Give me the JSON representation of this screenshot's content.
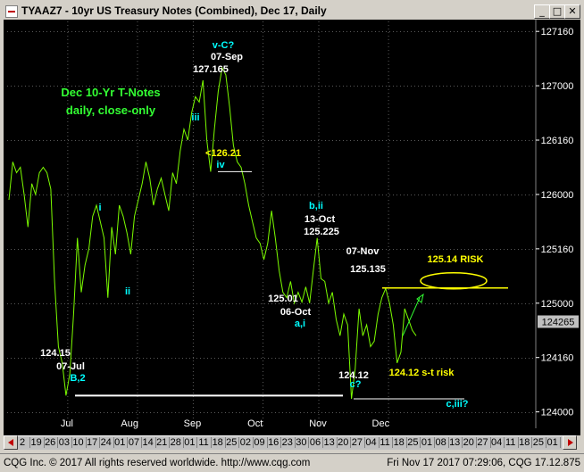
{
  "window": {
    "title": "TYAAZ7 - 10yr US Treasury Notes (Combined), Dec 17, Daily",
    "minimize_glyph": "_",
    "maximize_glyph": "□",
    "close_glyph": "✕",
    "icons": [
      "app-icon",
      "minimize-icon",
      "maximize-icon",
      "close-icon",
      "scroll-left-icon",
      "scroll-right-icon"
    ]
  },
  "status": {
    "left": "CQG Inc. © 2017 All rights reserved worldwide. http://www.cqg.com",
    "right": "Fri Nov 17 2017 07:29:06, CQG 17.12.875"
  },
  "colors": {
    "background": "#000000",
    "price_line": "#7cfc00",
    "label_white": "#ffffff",
    "label_cyan": "#00ffff",
    "label_yellow": "#ffff00",
    "annotation_green": "#33ff33",
    "grid": "#5a5a5a",
    "axis_text": "#ffffff",
    "time_axis_bg": "#c0c0c0",
    "price_box_bg": "#c0c0c0"
  },
  "chart_data": {
    "type": "line",
    "symbol": "TYAAZ7",
    "price_axis": {
      "min": 123.85,
      "max": 127.4,
      "tick_values": [
        127.5,
        127.0,
        126.5,
        126.0,
        125.5,
        125.0,
        124.5,
        124.0
      ],
      "tick_labels": [
        "127160",
        "127000",
        "126160",
        "126000",
        "125160",
        "125000",
        "124160",
        "124000"
      ],
      "last_price_label": "124265",
      "last_price_value": 124.83
    },
    "time_axis": {
      "day_labels": [
        "2",
        "19",
        "26",
        "03",
        "10",
        "17",
        "24",
        "01",
        "07",
        "14",
        "21",
        "28",
        "01",
        "11",
        "18",
        "25",
        "02",
        "09",
        "16",
        "23",
        "30",
        "06",
        "13",
        "20",
        "27",
        "04",
        "11",
        "18",
        "25",
        "01",
        "08",
        "13",
        "20",
        "27",
        "04",
        "11",
        "18",
        "25",
        "01"
      ],
      "month_labels": [
        {
          "text": "Jul",
          "index": 4.5
        },
        {
          "text": "Aug",
          "index": 9
        },
        {
          "text": "Sep",
          "index": 13.5
        },
        {
          "text": "Oct",
          "index": 18
        },
        {
          "text": "Nov",
          "index": 22.5
        },
        {
          "text": "Dec",
          "index": 27
        }
      ],
      "highlighted_labels": [
        "01",
        "Dec",
        "17"
      ]
    },
    "series": [
      {
        "values": [
          125.95,
          126.3,
          126.2,
          126.25,
          126.0,
          125.7,
          126.1,
          126.0,
          126.2,
          126.25,
          126.2,
          126.05,
          125.2,
          124.6,
          124.45,
          124.15,
          124.35,
          124.9,
          125.6,
          125.1,
          125.35,
          125.5,
          125.8,
          125.9,
          125.75,
          125.6,
          125.05,
          125.7,
          125.45,
          125.9,
          125.8,
          125.65,
          125.45,
          125.8,
          125.95,
          126.1,
          126.3,
          126.15,
          125.9,
          126.05,
          126.15,
          126.0,
          125.85,
          126.2,
          126.1,
          126.4,
          126.6,
          126.5,
          126.75,
          126.9,
          126.85,
          127.05,
          126.5,
          126.21,
          126.6,
          126.95,
          127.165,
          127.1,
          126.8,
          126.45,
          126.3,
          126.25,
          126.1,
          125.9,
          125.75,
          125.6,
          125.55,
          125.4,
          125.55,
          125.85,
          125.6,
          125.3,
          125.1,
          125.05,
          125.2,
          125.0,
          125.1,
          125.01,
          125.15,
          125.0,
          125.3,
          125.6,
          125.225,
          125.2,
          125.0,
          125.1,
          124.85,
          124.7,
          124.9,
          124.8,
          124.12,
          124.4,
          124.95,
          124.7,
          124.8,
          124.6,
          124.65,
          124.9,
          125.05,
          125.135,
          125.0,
          124.8,
          124.45,
          124.55,
          124.95,
          124.85,
          124.75,
          124.7
        ]
      }
    ],
    "annotations": [
      {
        "text": "Dec 10-Yr T-Notes",
        "color": "green"
      },
      {
        "text": "daily, close-only",
        "color": "green"
      },
      {
        "text": "v-C?",
        "color": "cyan"
      },
      {
        "text": "07-Sep",
        "color": "white"
      },
      {
        "text": "127.165",
        "color": "white"
      },
      {
        "text": "iii",
        "color": "cyan"
      },
      {
        "text": "<126.21",
        "color": "yellow"
      },
      {
        "text": "iv",
        "color": "cyan"
      },
      {
        "text": "i",
        "color": "cyan"
      },
      {
        "text": "ii",
        "color": "cyan"
      },
      {
        "text": "b,ii",
        "color": "cyan"
      },
      {
        "text": "13-Oct",
        "color": "white"
      },
      {
        "text": "125.225",
        "color": "white"
      },
      {
        "text": "125.01",
        "color": "white"
      },
      {
        "text": "06-Oct",
        "color": "white"
      },
      {
        "text": "a,i",
        "color": "cyan"
      },
      {
        "text": "07-Nov",
        "color": "white"
      },
      {
        "text": "125.135",
        "color": "white"
      },
      {
        "text": "125.14 RISK",
        "color": "yellow"
      },
      {
        "text": "124.15",
        "color": "white"
      },
      {
        "text": "07-Jul",
        "color": "white"
      },
      {
        "text": "B,2",
        "color": "cyan"
      },
      {
        "text": "124.12",
        "color": "white"
      },
      {
        "text": "c?",
        "color": "cyan"
      },
      {
        "text": "124.12 s-t risk",
        "color": "yellow"
      },
      {
        "text": "c,iii?",
        "color": "cyan"
      }
    ],
    "levels": [
      {
        "name": "support-124.15",
        "value": 124.15,
        "color": "white"
      },
      {
        "name": "risk-125.14",
        "value": 125.14,
        "color": "yellow"
      },
      {
        "name": "st-risk-124.12",
        "value": 124.12,
        "color": "yellow"
      },
      {
        "name": "level-126.21",
        "value": 126.21,
        "color": "white"
      }
    ],
    "grid": true
  }
}
